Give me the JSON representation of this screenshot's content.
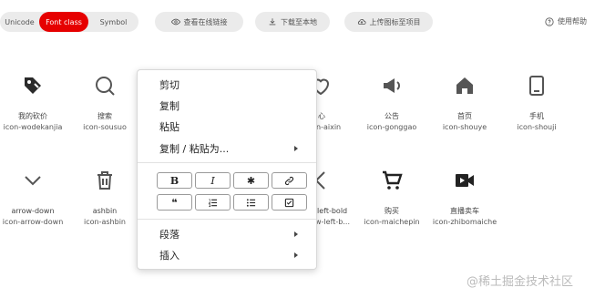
{
  "toolbar": {
    "tabs": [
      {
        "label": "Unicode"
      },
      {
        "label": "Font class"
      },
      {
        "label": "Symbol"
      }
    ],
    "view_online": "查看在线链接",
    "download": "下载至本地",
    "upload": "上传图标至项目",
    "help": "使用帮助",
    "active_color": "#e60000"
  },
  "icons_row1": [
    {
      "name": "我的砍价",
      "cls": "icon-wodekanjia",
      "icon": "tag-icon"
    },
    {
      "name": "搜索",
      "cls": "icon-sousuo",
      "icon": "search-icon"
    },
    {
      "name": "爱心",
      "cls": "icon-aixin",
      "icon": "heart-icon"
    },
    {
      "name": "公告",
      "cls": "icon-gonggao",
      "icon": "megaphone-icon"
    },
    {
      "name": "首页",
      "cls": "icon-shouye",
      "icon": "home-icon"
    },
    {
      "name": "手机",
      "cls": "icon-shouji",
      "icon": "phone-icon"
    }
  ],
  "icons_row2": [
    {
      "name": "arrow-down",
      "cls": "icon-arrow-down",
      "icon": "chevron-down-icon"
    },
    {
      "name": "ashbin",
      "cls": "icon-ashbin",
      "icon": "trash-icon"
    },
    {
      "name": "arrow-left-bold",
      "cls": "icon-arrow-left-b...",
      "icon": "chevron-left-icon"
    },
    {
      "name": "购买",
      "cls": "icon-maichepin",
      "icon": "cart-icon"
    },
    {
      "name": "直播卖车",
      "cls": "icon-zhibomaiche",
      "icon": "video-icon"
    }
  ],
  "row2_partial": {
    "name": "left-bold",
    "cls": "w-left-b..."
  },
  "row1_partial": {
    "name": "心",
    "cls": "n-aixin"
  },
  "context_menu": {
    "cut": "剪切",
    "copy": "复制",
    "paste": "粘贴",
    "copy_paste_as": "复制 / 粘贴为...",
    "format_buttons": [
      {
        "label": "B",
        "icon": "bold-icon"
      },
      {
        "label": "I",
        "icon": "italic-icon"
      },
      {
        "label": "✱",
        "icon": "asterisk-icon"
      },
      {
        "label": "",
        "icon": "link-icon"
      },
      {
        "label": "❝",
        "icon": "quote-icon"
      },
      {
        "label": "",
        "icon": "ordered-list-icon"
      },
      {
        "label": "",
        "icon": "bullet-list-icon"
      },
      {
        "label": "",
        "icon": "checkbox-icon"
      }
    ],
    "paragraph": "段落",
    "insert": "插入"
  },
  "watermark": "@稀土掘金技术社区"
}
